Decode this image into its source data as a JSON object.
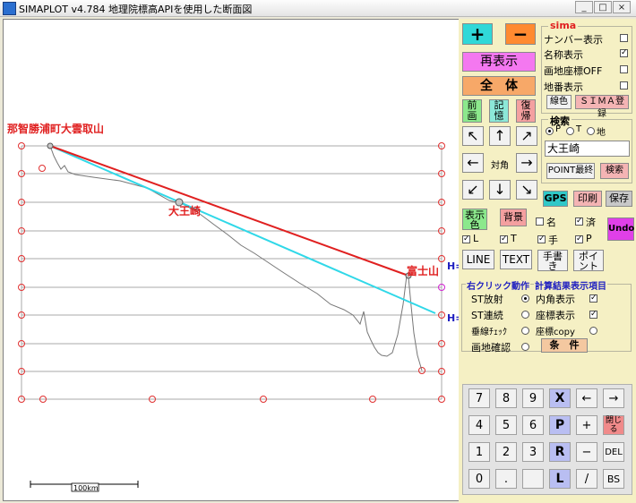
{
  "window": {
    "title": "SIMAPLOT v4.784 地理院標高APIを使用した断面図",
    "minimize": "_",
    "maximize": "□",
    "close": "×"
  },
  "canvas": {
    "label_start": "那智勝浦町大雲取山",
    "label_mid": "大王崎",
    "label_end": "富士山",
    "h_marker1": "H=",
    "h_marker2": "H=",
    "scale_label": "100km"
  },
  "panel": {
    "plus": "+",
    "minus": "−",
    "redraw": "再表示",
    "whole": "全　体",
    "prev_view": "前画",
    "memory": "記憶",
    "restore": "復帰",
    "center_label": "対角",
    "display_color": "表示色",
    "background": "背景",
    "gps": "GPS",
    "print": "印刷",
    "save": "保存",
    "undo": "Undo",
    "line": "LINE",
    "text": "TEXT",
    "freehand": "手書き",
    "point": "ポイント",
    "arrows": {
      "ul": "↖",
      "up": "↑",
      "ur": "↗",
      "left": "←",
      "right": "→",
      "dl": "↙",
      "down": "↓",
      "dr": "↘"
    },
    "layer_checks": [
      {
        "label": "名",
        "checked": false
      },
      {
        "label": "済",
        "checked": true
      },
      {
        "label": "L",
        "checked": true
      },
      {
        "label": "T",
        "checked": true
      },
      {
        "label": "手",
        "checked": true
      },
      {
        "label": "P",
        "checked": true
      }
    ],
    "sima": {
      "title": "sima",
      "options": [
        {
          "label": "ナンバー表示",
          "checked": false
        },
        {
          "label": "名称表示",
          "checked": true
        },
        {
          "label": "画地座標OFF",
          "checked": false
        },
        {
          "label": "地番表示",
          "checked": false
        }
      ],
      "line_color": "線色",
      "register": "ＳＩＭＡ登録"
    },
    "search": {
      "title": "検索",
      "radios": [
        {
          "label": "P",
          "on": true
        },
        {
          "label": "T",
          "on": false
        },
        {
          "label": "地",
          "on": false
        }
      ],
      "value": "大王崎",
      "point_last": "POINT最終",
      "search_button": "検索"
    },
    "rightclick": {
      "title": "右クリック動作",
      "options": [
        {
          "label": "ST放射",
          "on": true
        },
        {
          "label": "ST連続",
          "on": false
        },
        {
          "label": "垂線ﾁｪｯｸ",
          "on": false
        },
        {
          "label": "画地確認",
          "on": false
        }
      ]
    },
    "calc": {
      "title": "計算結果表示項目",
      "options": [
        {
          "label": "内角表示",
          "checked": true
        },
        {
          "label": "座標表示",
          "checked": true
        },
        {
          "label": "座標copy",
          "checked": false
        }
      ],
      "conditions": "条　件"
    },
    "keypad": [
      [
        "7",
        "8",
        "9",
        "X",
        "←",
        "→"
      ],
      [
        "4",
        "5",
        "6",
        "P",
        "+",
        "閉じる"
      ],
      [
        "1",
        "2",
        "3",
        "R",
        "−",
        "DEL"
      ],
      [
        "0",
        ".",
        "",
        "L",
        "/",
        "BS"
      ]
    ]
  }
}
